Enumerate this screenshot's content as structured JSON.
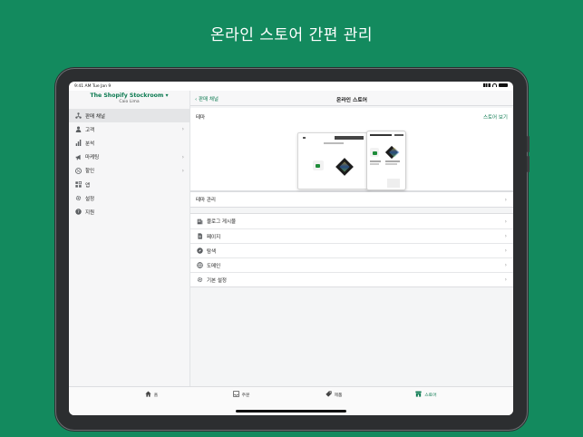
{
  "headline": "온라인 스토어 간편 관리",
  "status": {
    "time": "9:41 AM   Tue Jan 9"
  },
  "store": {
    "name": "The Shopify Stockroom ▾",
    "user": "Caio Lima"
  },
  "sidebar": {
    "items": [
      {
        "label": "판매 채널",
        "icon": "share-icon",
        "active": true,
        "chevron": false
      },
      {
        "label": "고객",
        "icon": "person-icon",
        "chevron": true
      },
      {
        "label": "분석",
        "icon": "bar-chart-icon",
        "chevron": false
      },
      {
        "label": "마케팅",
        "icon": "megaphone-icon",
        "chevron": true
      },
      {
        "label": "할인",
        "icon": "discount-icon",
        "chevron": true
      },
      {
        "label": "앱",
        "icon": "apps-icon",
        "chevron": false
      },
      {
        "label": "설정",
        "icon": "gear-icon",
        "chevron": false
      },
      {
        "label": "지원",
        "icon": "help-icon",
        "chevron": false
      }
    ]
  },
  "main": {
    "back_label": "판매 채널",
    "title": "온라인 스토어",
    "theme_label": "테마",
    "view_store": "스토어 보기",
    "manage_theme": "테마 관리",
    "rows": [
      {
        "label": "블로그 게시물",
        "icon": "blog-icon"
      },
      {
        "label": "페이지",
        "icon": "page-icon"
      },
      {
        "label": "탐색",
        "icon": "compass-icon"
      },
      {
        "label": "도메인",
        "icon": "globe-icon"
      },
      {
        "label": "기본 설정",
        "icon": "gear-icon"
      }
    ]
  },
  "tabbar": {
    "tabs": [
      {
        "label": "홈",
        "icon": "home-icon"
      },
      {
        "label": "주문",
        "icon": "inbox-icon"
      },
      {
        "label": "제품",
        "icon": "tag-icon"
      },
      {
        "label": "스토어",
        "icon": "store-icon",
        "active": true
      }
    ]
  },
  "colors": {
    "brand_green": "#138a5e",
    "accent": "#0c7a51"
  }
}
